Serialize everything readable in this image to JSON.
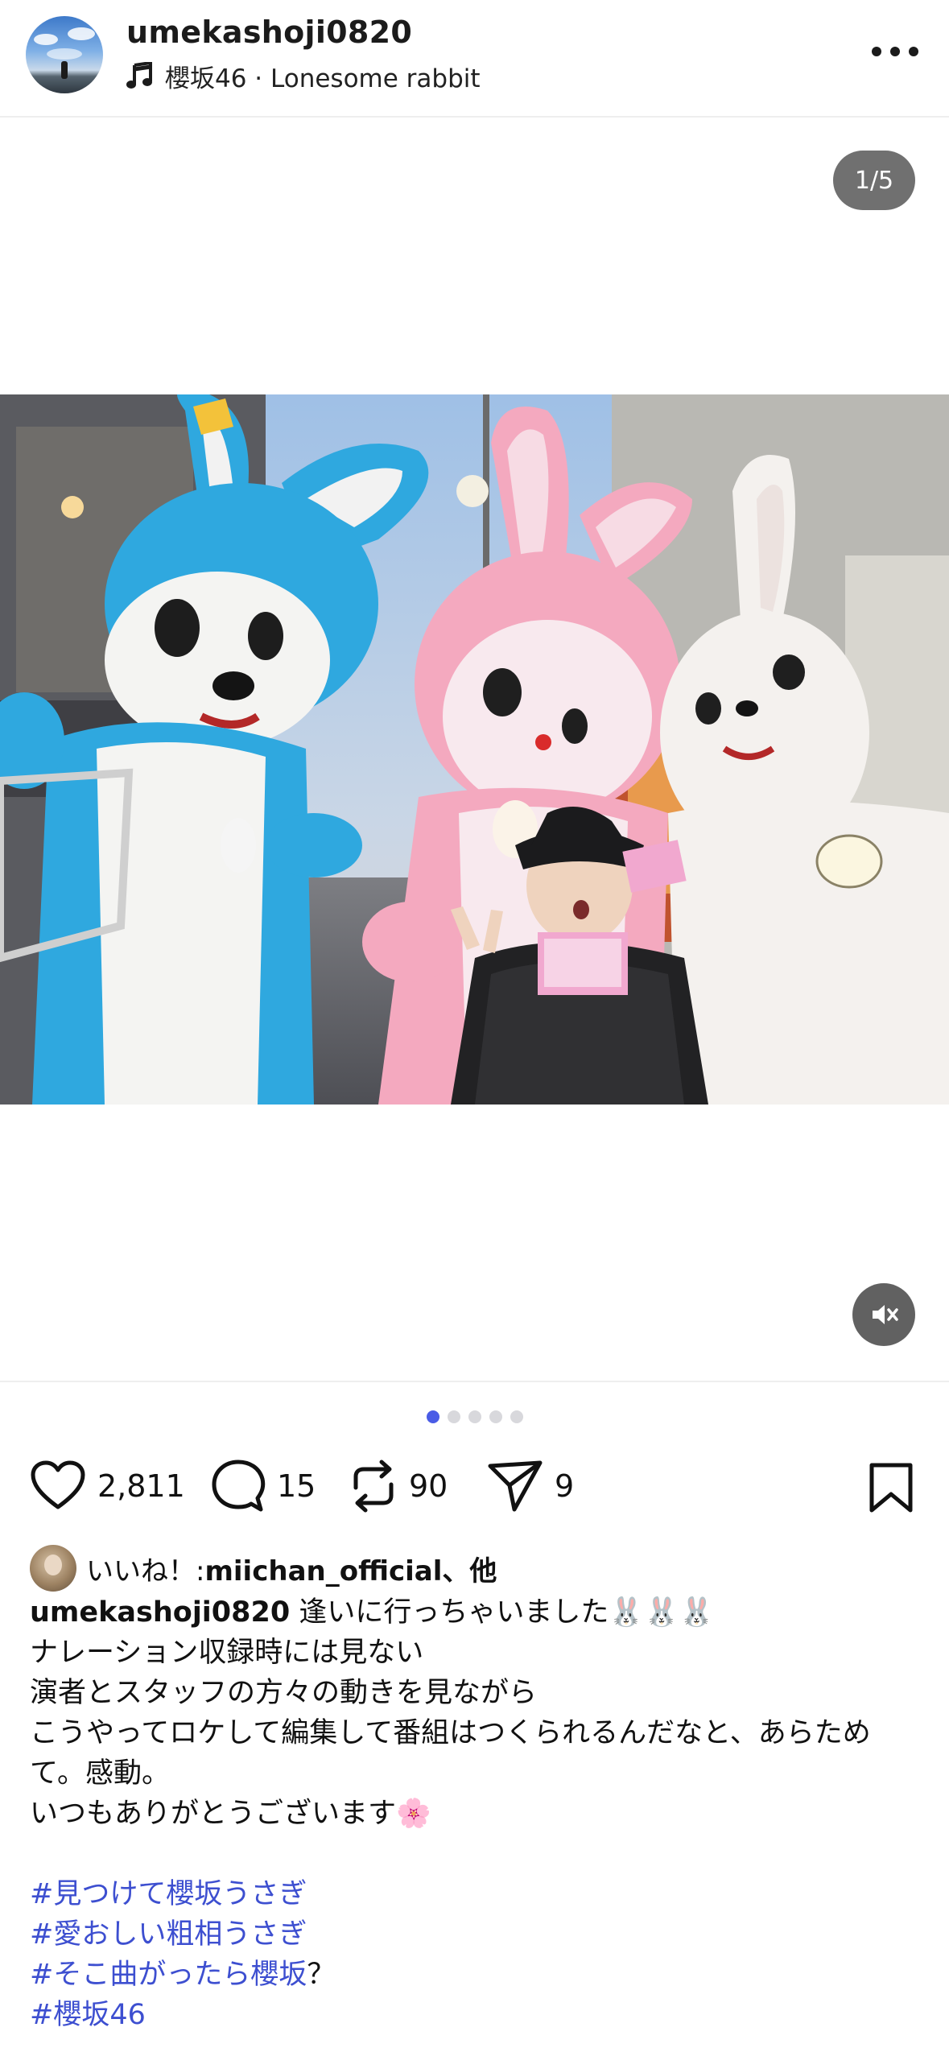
{
  "header": {
    "username": "umekashoji0820",
    "music": "櫻坂46 · Lonesome rabbit"
  },
  "media": {
    "counter": "1/5",
    "total_slides": 5,
    "active_slide": 1
  },
  "actions": {
    "likes": "2,811",
    "comments": "15",
    "reposts": "90",
    "shares": "9"
  },
  "liked_by": {
    "prefix": "いいね！: ",
    "names": "miichan_official、他"
  },
  "caption": {
    "username": "umekashoji0820",
    "first_line": " 逢いに行っちゃいました🐰🐰🐰",
    "lines": [
      "ナレーション収録時には見ない",
      "演者とスタッフの方々の動きを見ながら",
      "こうやってロケして編集して番組はつくられるんだなと、あらためて。感動。",
      "いつもありがとうございます🌸"
    ],
    "hashtags": [
      {
        "tag": "#見つけて櫻坂うさぎ",
        "suffix": ""
      },
      {
        "tag": "#愛おしい粗相うさぎ",
        "suffix": ""
      },
      {
        "tag": "#そこ曲がったら櫻坂",
        "suffix": "？"
      },
      {
        "tag": "#櫻坂46",
        "suffix": ""
      }
    ]
  },
  "colors": {
    "accent": "#4a5ce6",
    "hashtag": "#3d4fd0",
    "rabbit_blue": "#2fa8df",
    "rabbit_pink": "#f4a9bf",
    "rabbit_white": "#f4f1ee"
  }
}
